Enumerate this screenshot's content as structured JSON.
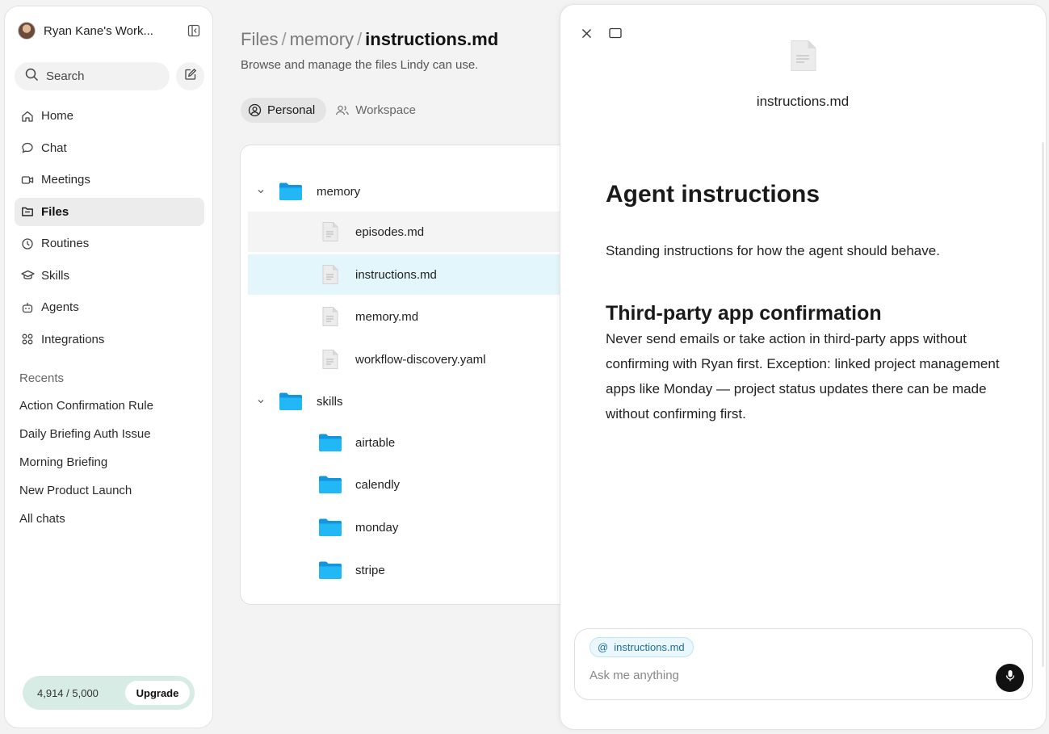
{
  "sidebar": {
    "workspace_name": "Ryan Kane's Work...",
    "search_label": "Search",
    "nav": [
      {
        "label": "Home",
        "icon": "home-icon"
      },
      {
        "label": "Chat",
        "icon": "chat-bubble-icon"
      },
      {
        "label": "Meetings",
        "icon": "video-camera-icon"
      },
      {
        "label": "Files",
        "icon": "folder-icon"
      },
      {
        "label": "Routines",
        "icon": "clock-icon"
      },
      {
        "label": "Skills",
        "icon": "graduation-cap-icon"
      },
      {
        "label": "Agents",
        "icon": "robot-icon"
      },
      {
        "label": "Integrations",
        "icon": "grid-icon"
      }
    ],
    "active_nav": "Files",
    "recents_title": "Recents",
    "recents": [
      "Action Confirmation Rule",
      "Daily Briefing Auth Issue",
      "Morning Briefing",
      "New Product Launch",
      "All chats"
    ],
    "credits": "4,914 / 5,000",
    "upgrade_label": "Upgrade"
  },
  "main": {
    "breadcrumb": [
      "Files",
      "memory",
      "instructions.md"
    ],
    "breadcrumb_sep": "/",
    "subtitle": "Browse and manage the files Lindy can use.",
    "tabs": [
      {
        "label": "Personal",
        "icon": "user-circle-icon",
        "active": true
      },
      {
        "label": "Workspace",
        "icon": "users-icon",
        "active": false
      }
    ],
    "tree": [
      {
        "type": "folder",
        "label": "memory",
        "expanded": true,
        "depth": 0
      },
      {
        "type": "file",
        "label": "episodes.md",
        "depth": 1,
        "state": "hover"
      },
      {
        "type": "file",
        "label": "instructions.md",
        "depth": 1,
        "state": "selected"
      },
      {
        "type": "file",
        "label": "memory.md",
        "depth": 1
      },
      {
        "type": "file",
        "label": "workflow-discovery.yaml",
        "depth": 1
      },
      {
        "type": "folder",
        "label": "skills",
        "expanded": true,
        "depth": 0
      },
      {
        "type": "folder",
        "label": "airtable",
        "depth": 1
      },
      {
        "type": "folder",
        "label": "calendly",
        "depth": 1
      },
      {
        "type": "folder",
        "label": "monday",
        "depth": 1
      },
      {
        "type": "folder",
        "label": "stripe",
        "depth": 1
      }
    ]
  },
  "preview": {
    "filename": "instructions.md",
    "doc": {
      "h1": "Agent instructions",
      "intro": "Standing instructions for how the agent should behave.",
      "h2": "Third-party app confirmation",
      "body": "Never send emails or take action in third-party apps without confirming with Ryan first. Exception: linked project management apps like Monday — project status updates there can be made without confirming first."
    },
    "chat": {
      "mention": "instructions.md",
      "placeholder": "Ask me anything"
    }
  },
  "colors": {
    "folder_blue": "#1aa8f0",
    "selected_row": "#e3f6fb",
    "credits_bg": "#d6ece4",
    "mention_text": "#1d6f98"
  }
}
